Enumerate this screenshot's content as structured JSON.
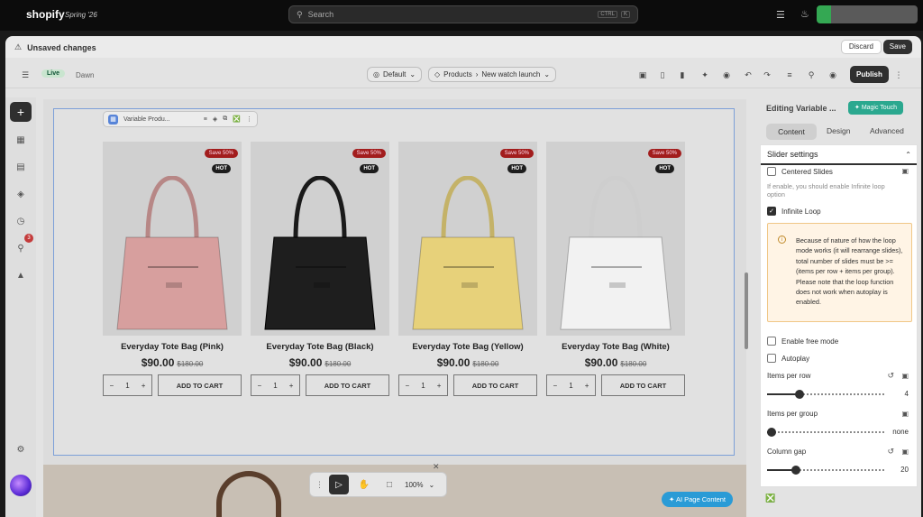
{
  "topbar": {
    "brand": "shopify",
    "edition": "Spring '26",
    "search_placeholder": "Search",
    "shortcut_key1": "CTRL",
    "shortcut_key2": "K"
  },
  "unsaved": {
    "title": "Unsaved changes",
    "discard": "Discard",
    "save": "Save"
  },
  "editor": {
    "status": "Live",
    "theme": "Dawn",
    "template": "Default",
    "products": "Products",
    "product": "New watch launch",
    "publish": "Publish"
  },
  "rail": {
    "notification_count": "3"
  },
  "selection_toolbar": {
    "label": "Variable Produ..."
  },
  "products": [
    {
      "name": "Everyday Tote Bag (Pink)",
      "price": "$90.00",
      "compare": "$180.00",
      "color": "#d79f9e",
      "badge_save": "Save 50%",
      "badge_hot": "HOT",
      "qty": "1",
      "cta": "ADD TO CART"
    },
    {
      "name": "Everyday Tote Bag (Black)",
      "price": "$90.00",
      "compare": "$180.00",
      "color": "#1e1e1e",
      "badge_save": "Save 50%",
      "badge_hot": "HOT",
      "qty": "1",
      "cta": "ADD TO CART"
    },
    {
      "name": "Everyday Tote Bag (Yellow)",
      "price": "$90.00",
      "compare": "$180.00",
      "color": "#e7d17a",
      "badge_save": "Save 50%",
      "badge_hot": "HOT",
      "qty": "1",
      "cta": "ADD TO CART"
    },
    {
      "name": "Everyday Tote Bag (White)",
      "price": "$90.00",
      "compare": "$180.00",
      "color": "#f2f2f2",
      "badge_save": "Save 50%",
      "badge_hot": "HOT",
      "qty": "1",
      "cta": "ADD TO CART"
    }
  ],
  "playbar": {
    "zoom": "100%"
  },
  "ai_button": "AI Page Content",
  "panel": {
    "title": "Editing Variable ...",
    "magic": "Magic Touch",
    "tabs": [
      "Content",
      "Design",
      "Advanced"
    ],
    "section_title": "Slider settings",
    "centered_slides": "Centered Slides",
    "centered_note": "If enable, you should enable Infinite loop option",
    "infinite_loop": "Infinite Loop",
    "warning": "Because of nature of how the loop mode works (it will rearrange slides), total number of slides must be >= (items per row + items per group). Please note that the loop function does not work when autoplay is enabled.",
    "free_mode": "Enable free mode",
    "autoplay": "Autoplay",
    "items_per_row_label": "Items per row",
    "items_per_row": "4",
    "items_per_row_fraction": 0.25,
    "items_per_group_label": "Items per group",
    "items_per_group": "none",
    "items_per_group_fraction": 0,
    "column_gap_label": "Column gap",
    "column_gap": "20",
    "column_gap_fraction": 0.22,
    "accent_color": "#303030"
  }
}
